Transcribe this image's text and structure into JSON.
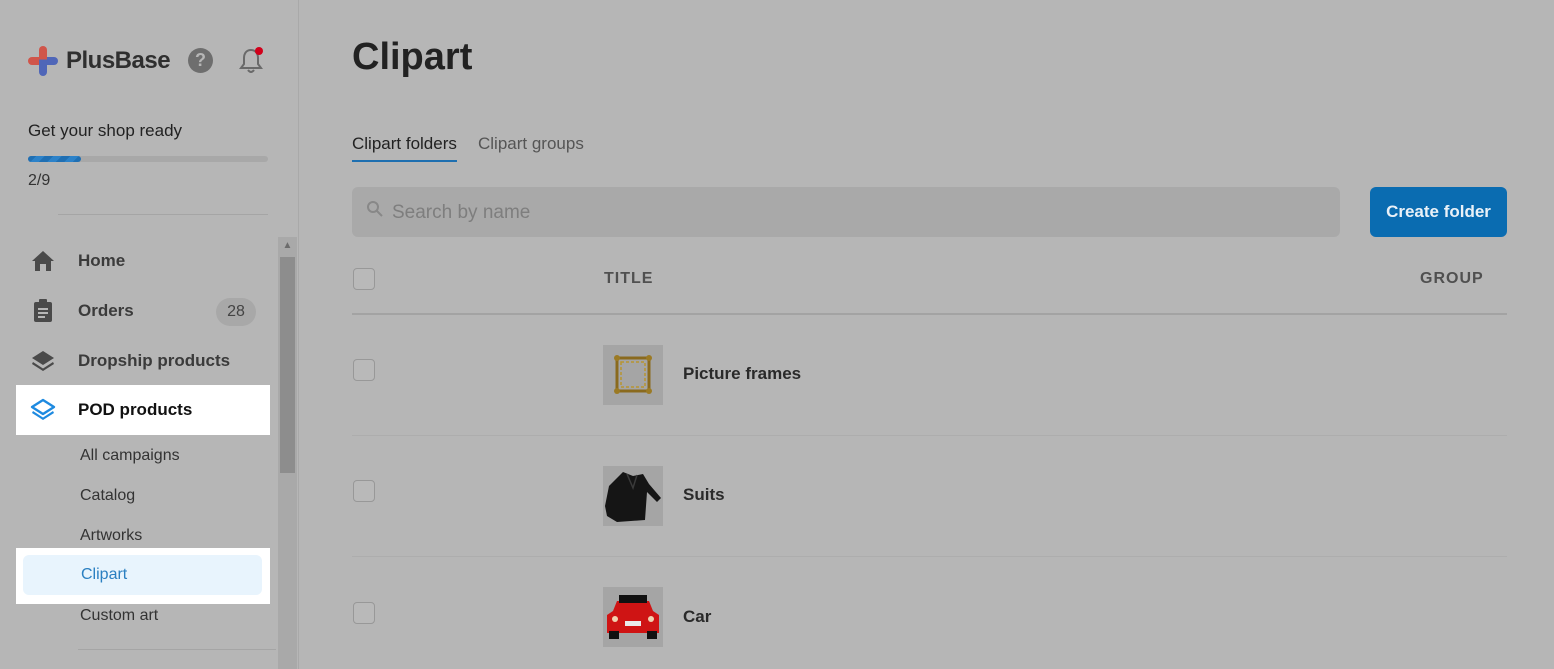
{
  "sidebar": {
    "brand": "PlusBase",
    "setup": {
      "title": "Get your shop ready",
      "progress_text": "2/9",
      "progress_fraction": 0.22
    },
    "nav": [
      {
        "label": "Home",
        "icon": "home-icon"
      },
      {
        "label": "Orders",
        "icon": "clipboard-icon",
        "badge": "28"
      },
      {
        "label": "Dropship products",
        "icon": "layers-icon"
      },
      {
        "label": "POD products",
        "icon": "layers-icon",
        "active": true
      }
    ],
    "sub_items": [
      "All campaigns",
      "Catalog",
      "Artworks",
      "Clipart",
      "Custom art"
    ],
    "active_sub": "Clipart"
  },
  "main": {
    "title": "Clipart",
    "tabs": [
      "Clipart folders",
      "Clipart groups"
    ],
    "active_tab": "Clipart folders",
    "search_placeholder": "Search by name",
    "create_button": "Create folder",
    "columns": [
      "TITLE",
      "GROUP"
    ],
    "rows": [
      {
        "title": "Picture frames",
        "thumb": "picture-frame-thumbnail"
      },
      {
        "title": "Suits",
        "thumb": "suit-jacket-thumbnail"
      },
      {
        "title": "Car",
        "thumb": "red-car-thumbnail"
      }
    ]
  },
  "colors": {
    "accent": "#0a6cb1",
    "active_text": "#2a7fc1",
    "notification_dot": "#d1001a"
  }
}
